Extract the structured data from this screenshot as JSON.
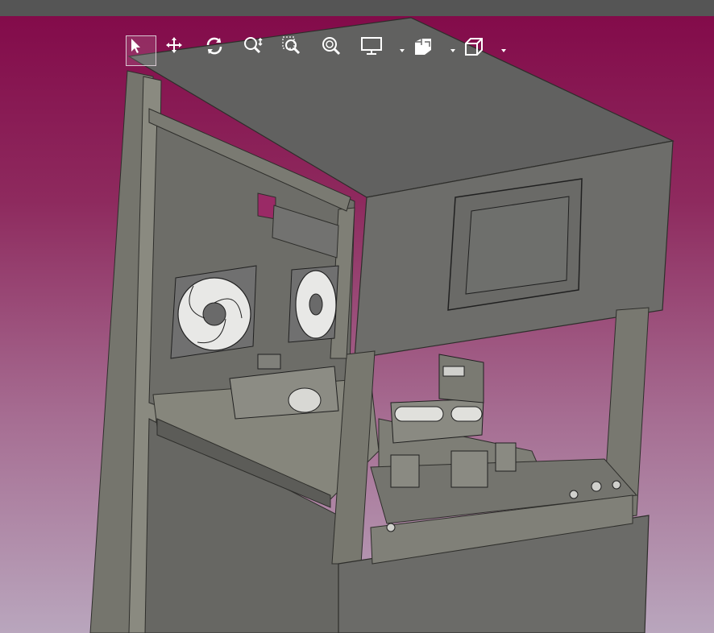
{
  "app": {
    "topbar_color": "#555555"
  },
  "viewport": {
    "background_top": "#830b4a",
    "background_bottom": "#b9a6bd"
  },
  "toolbar": {
    "tools": [
      {
        "name": "select-icon",
        "active": true
      },
      {
        "name": "pan-icon",
        "active": false
      },
      {
        "name": "rotate-icon",
        "active": false
      },
      {
        "name": "zoom-icon",
        "active": false
      },
      {
        "name": "zoom-window-icon",
        "active": false
      },
      {
        "name": "zoom-fit-icon",
        "active": false
      },
      {
        "name": "display-mode-icon",
        "active": false,
        "dropdown": true
      },
      {
        "name": "section-view-icon",
        "active": false,
        "dropdown": true
      },
      {
        "name": "view-orientation-icon",
        "active": false,
        "dropdown": true
      }
    ]
  },
  "model": {
    "body_color": "#6b6b68",
    "top_color": "#616160",
    "frame_color": "#7a7a72",
    "screen_color": "#6e6f6c"
  }
}
